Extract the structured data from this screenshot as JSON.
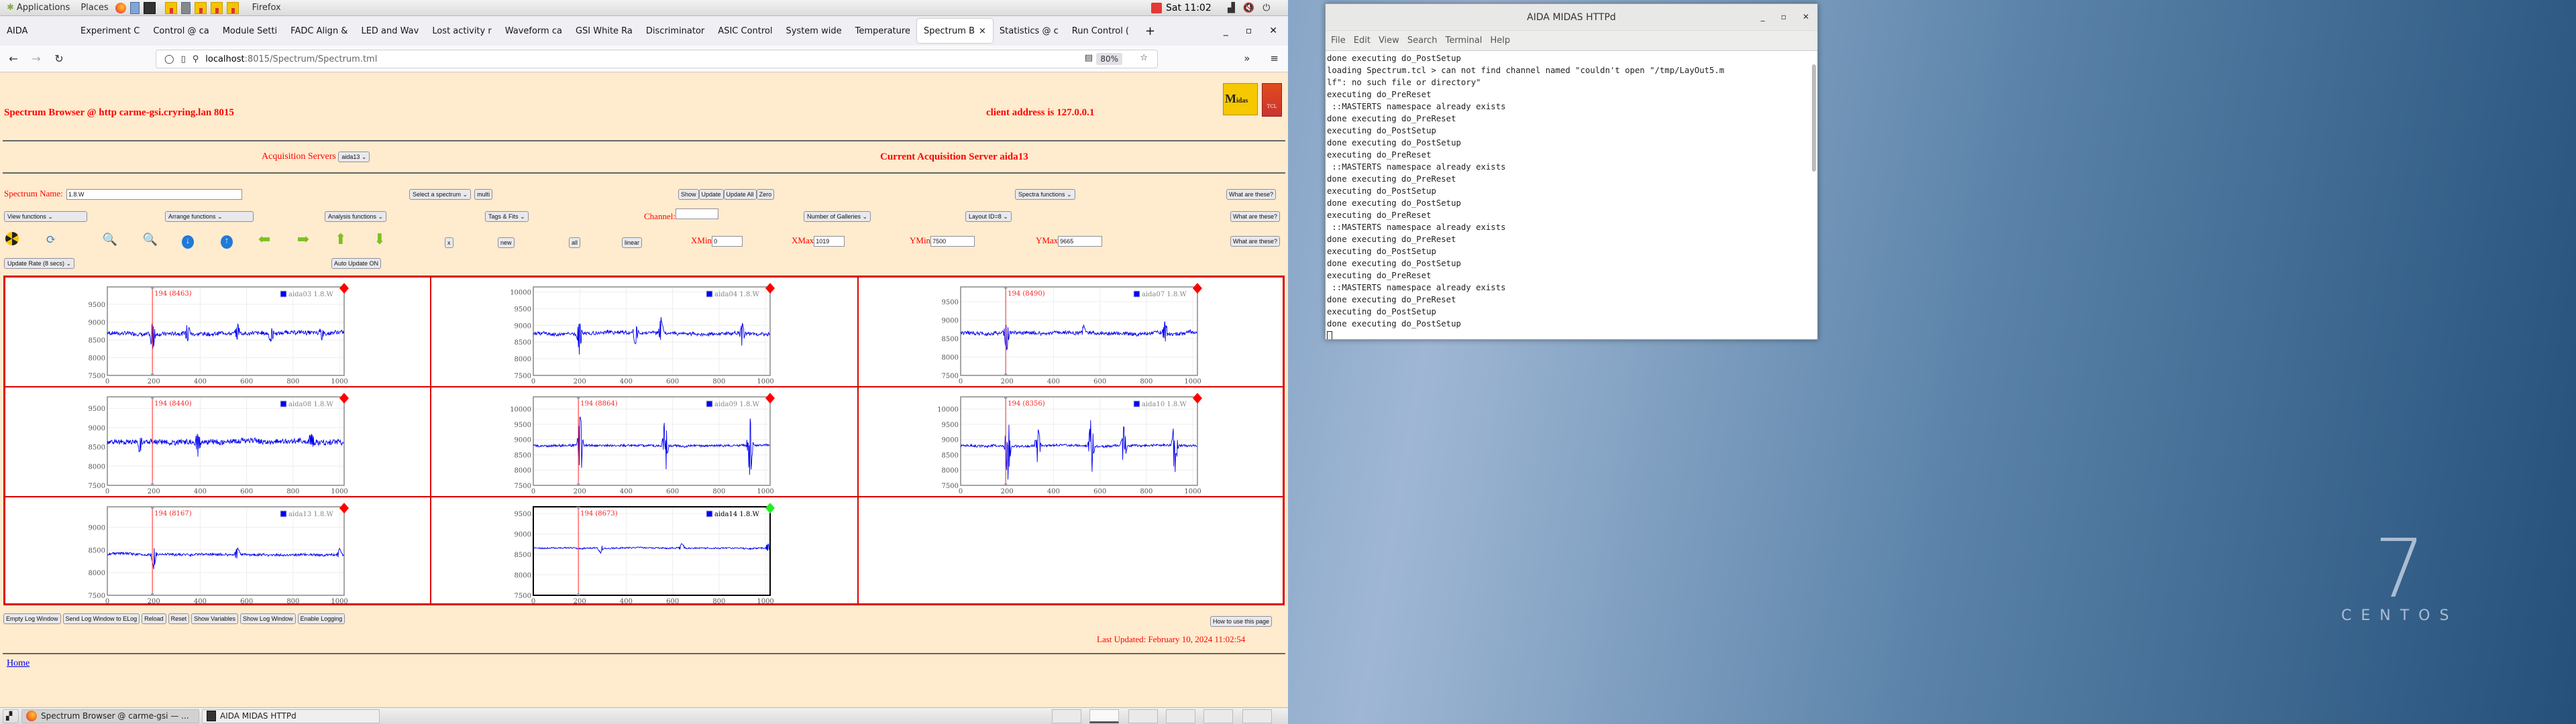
{
  "desktop": {
    "topbar": {
      "applications": "Applications",
      "places": "Places",
      "active_app": "Firefox",
      "clock": "Sat 11:02"
    },
    "wallpaper": {
      "version": "7",
      "name": "CENTOS"
    }
  },
  "browser": {
    "tabs": [
      {
        "label": "AIDA",
        "active": false
      },
      {
        "label": "Experiment C",
        "active": false
      },
      {
        "label": "Control @ ca",
        "active": false
      },
      {
        "label": "Module Setti",
        "active": false
      },
      {
        "label": "FADC Align &",
        "active": false
      },
      {
        "label": "LED and Wav",
        "active": false
      },
      {
        "label": "Lost activity r",
        "active": false
      },
      {
        "label": "Waveform ca",
        "active": false
      },
      {
        "label": "GSI White Ra",
        "active": false
      },
      {
        "label": "Discriminator",
        "active": false
      },
      {
        "label": "ASIC Control",
        "active": false
      },
      {
        "label": "System wide",
        "active": false
      },
      {
        "label": "Temperature",
        "active": false
      },
      {
        "label": "Spectrum B",
        "active": true
      },
      {
        "label": "Statistics @ c",
        "active": false
      },
      {
        "label": "Run Control (",
        "active": false
      }
    ],
    "url_host": "localhost",
    "url_path": ":8015/Spectrum/Spectrum.tml",
    "zoom": "80%"
  },
  "page": {
    "title": "Spectrum Browser @ http carme-gsi.cryring.lan 8015",
    "client_address": "client address is 127.0.0.1",
    "acq_servers_label": "Acquisition Servers",
    "acq_servers_value": "aida13",
    "current_server": "Current Acquisition Server aida13",
    "spectrum_name_label": "Spectrum Name:",
    "spectrum_name_value": "1.8.W",
    "select_spectrum": "Select a spectrum",
    "multi": "multi",
    "show": "Show",
    "update": "Update",
    "update_all": "Update All",
    "zero": "Zero",
    "spectra_functions": "Spectra functions",
    "what_are_these": "What are these?",
    "view_functions": "View functions",
    "arrange_functions": "Arrange functions",
    "analysis_functions": "Analysis functions",
    "tags_fits": "Tags & Fits",
    "channel_label": "Channel:",
    "channel_value": "",
    "num_galleries": "Number of Galleries",
    "layout_id": "Layout ID=8",
    "x_btn": "x",
    "new_btn": "new",
    "all_btn": "all",
    "linear_btn": "linear",
    "xmin_label": "XMin",
    "xmin_value": "0",
    "xmax_label": "XMax",
    "xmax_value": "1019",
    "ymin_label": "YMin",
    "ymin_value": "7500",
    "ymax_label": "YMax",
    "ymax_value": "9665",
    "update_rate": "Update Rate (8 secs)",
    "auto_update": "Auto Update ON",
    "bottom_buttons": [
      "Empty Log Window",
      "Send Log Window to ELog",
      "Reload",
      "Reset",
      "Show Variables",
      "Show Log Window",
      "Enable Logging"
    ],
    "how_to": "How to use this page",
    "last_updated": "Last Updated: February 10, 2024 11:02:54",
    "home": "Home"
  },
  "chart_data": [
    {
      "type": "line",
      "legend": "aida03 1.8.W",
      "cursor": {
        "x": 194,
        "label": "194 (8463)"
      },
      "xlim": [
        0,
        1020
      ],
      "ylim": [
        7500,
        9990
      ],
      "yticks": [
        7500,
        8000,
        8500,
        9000,
        9500
      ],
      "xticks": [
        0,
        200,
        400,
        600,
        800,
        1000
      ],
      "baseline": 8700,
      "noise": 120,
      "spikes": [
        [
          195,
          -500
        ],
        [
          345,
          300
        ],
        [
          560,
          250
        ],
        [
          705,
          -250
        ],
        [
          920,
          -200
        ]
      ],
      "marker": "red"
    },
    {
      "type": "line",
      "legend": "aida04 1.8.W",
      "cursor": null,
      "xlim": [
        0,
        1020
      ],
      "ylim": [
        7500,
        10150
      ],
      "yticks": [
        7500,
        8000,
        8500,
        9000,
        9500,
        10000
      ],
      "xticks": [
        0,
        200,
        400,
        600,
        800,
        1000
      ],
      "baseline": 8750,
      "noise": 110,
      "spikes": [
        [
          198,
          -600
        ],
        [
          440,
          -350
        ],
        [
          550,
          450
        ],
        [
          900,
          -450
        ]
      ],
      "marker": "red"
    },
    {
      "type": "line",
      "legend": "aida07 1.8.W",
      "cursor": {
        "x": 194,
        "label": "194 (8490)"
      },
      "xlim": [
        0,
        1020
      ],
      "ylim": [
        7500,
        9900
      ],
      "yticks": [
        7500,
        8000,
        8500,
        9000,
        9500
      ],
      "xticks": [
        0,
        200,
        400,
        600,
        800,
        1000
      ],
      "baseline": 8650,
      "noise": 110,
      "spikes": [
        [
          198,
          -500
        ],
        [
          880,
          350
        ],
        [
          530,
          200
        ]
      ],
      "marker": "red"
    },
    {
      "type": "line",
      "legend": "aida08 1.8.W",
      "cursor": {
        "x": 194,
        "label": "194 (8440)"
      },
      "xlim": [
        0,
        1020
      ],
      "ylim": [
        7500,
        9800
      ],
      "yticks": [
        7500,
        8000,
        8500,
        9000,
        9500
      ],
      "xticks": [
        0,
        200,
        400,
        600,
        800,
        1000
      ],
      "baseline": 8620,
      "noise": 150,
      "spikes": [
        [
          140,
          -300
        ],
        [
          390,
          -350
        ],
        [
          880,
          250
        ]
      ],
      "marker": "red"
    },
    {
      "type": "line",
      "legend": "aida09 1.8.W",
      "cursor": {
        "x": 194,
        "label": "194 (8864)"
      },
      "xlim": [
        0,
        1020
      ],
      "ylim": [
        7500,
        10400
      ],
      "yticks": [
        7500,
        8000,
        8500,
        9000,
        9500,
        10000
      ],
      "xticks": [
        0,
        200,
        400,
        600,
        800,
        1000
      ],
      "baseline": 8800,
      "noise": 80,
      "spikes": [
        [
          200,
          650
        ],
        [
          205,
          -700
        ],
        [
          565,
          600
        ],
        [
          570,
          -650
        ],
        [
          930,
          550
        ],
        [
          935,
          -850
        ]
      ],
      "marker": "red"
    },
    {
      "type": "line",
      "legend": "aida10 1.8.W",
      "cursor": {
        "x": 194,
        "label": "194 (8356)"
      },
      "xlim": [
        0,
        1020
      ],
      "ylim": [
        7500,
        10400
      ],
      "yticks": [
        7500,
        8000,
        8500,
        9000,
        9500,
        10000
      ],
      "xticks": [
        0,
        200,
        400,
        600,
        800,
        1000
      ],
      "baseline": 8800,
      "noise": 80,
      "spikes": [
        [
          200,
          700
        ],
        [
          205,
          -850
        ],
        [
          330,
          450
        ],
        [
          335,
          -400
        ],
        [
          560,
          600
        ],
        [
          565,
          -700
        ],
        [
          700,
          500
        ],
        [
          705,
          -400
        ],
        [
          920,
          600
        ],
        [
          925,
          -700
        ]
      ],
      "marker": "red"
    },
    {
      "type": "line",
      "legend": "aida13 1.8.W",
      "cursor": {
        "x": 194,
        "label": "194 (8167)"
      },
      "xlim": [
        0,
        1020
      ],
      "ylim": [
        7500,
        9450
      ],
      "yticks": [
        7500,
        8000,
        8500,
        9000
      ],
      "xticks": [
        0,
        200,
        400,
        600,
        800,
        1000
      ],
      "baseline": 8400,
      "noise": 60,
      "spikes": [
        [
          200,
          -300
        ],
        [
          560,
          150
        ],
        [
          1000,
          120
        ]
      ],
      "marker": "red"
    },
    {
      "type": "line",
      "legend": "aida14 1.8.W",
      "cursor": {
        "x": 194,
        "label": "194 (8673)"
      },
      "xlim": [
        0,
        1020
      ],
      "ylim": [
        7500,
        9665
      ],
      "yticks": [
        7500,
        8000,
        8500,
        9000,
        9500
      ],
      "xticks": [
        0,
        200,
        400,
        600,
        800,
        1000
      ],
      "baseline": 8660,
      "noise": 40,
      "spikes": [
        [
          290,
          -120
        ],
        [
          640,
          120
        ],
        [
          1010,
          100
        ]
      ],
      "marker": "green",
      "selected": true
    }
  ],
  "taskbar": {
    "items": [
      {
        "label": "Spectrum Browser @ carme-gsi — ...",
        "active": true
      },
      {
        "label": "AIDA MIDAS HTTPd",
        "active": false
      }
    ]
  },
  "terminal": {
    "title": "AIDA MIDAS HTTPd",
    "menu": [
      "File",
      "Edit",
      "View",
      "Search",
      "Terminal",
      "Help"
    ],
    "lines": [
      "done executing do_PostSetup",
      "loading Spectrum.tcl > can not find channel named \"couldn't open \"/tmp/LayOut5.m",
      "lf\": no such file or directory\"",
      "executing do_PreReset",
      " ::MASTERTS namespace already exists",
      "done executing do_PreReset",
      "executing do_PostSetup",
      "done executing do_PostSetup",
      "executing do_PreReset",
      " ::MASTERTS namespace already exists",
      "done executing do_PreReset",
      "executing do_PostSetup",
      "done executing do_PostSetup",
      "executing do_PreReset",
      " ::MASTERTS namespace already exists",
      "done executing do_PreReset",
      "executing do_PostSetup",
      "done executing do_PostSetup",
      "executing do_PreReset",
      " ::MASTERTS namespace already exists",
      "done executing do_PreReset",
      "executing do_PostSetup",
      "done executing do_PostSetup"
    ]
  }
}
